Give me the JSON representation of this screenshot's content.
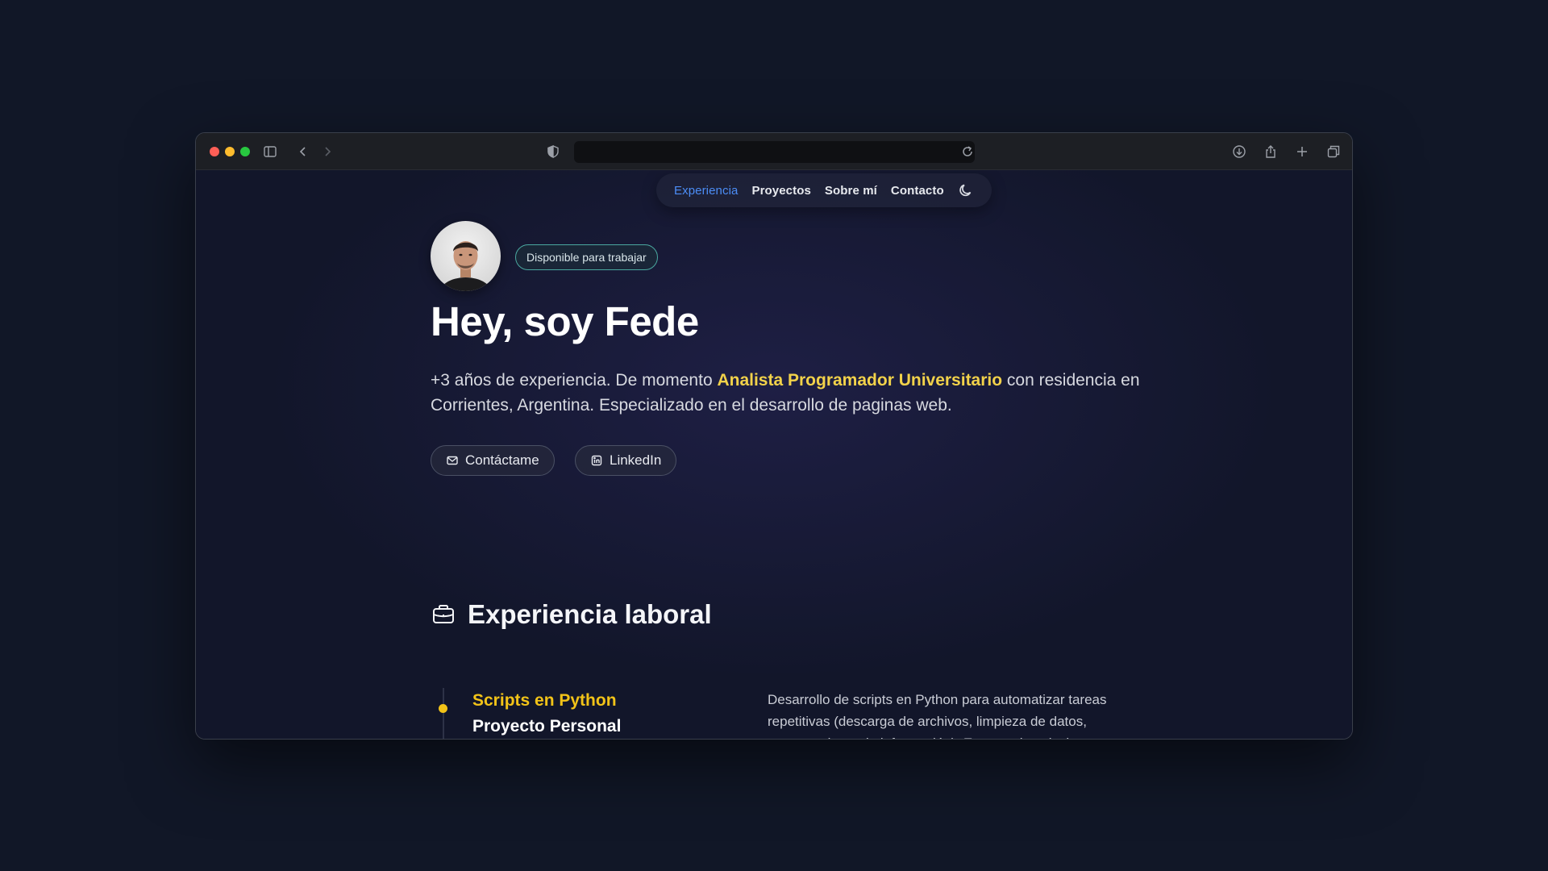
{
  "browser": {
    "url": "",
    "icons": [
      "sidebar-icon",
      "back-icon",
      "forward-icon",
      "shield-icon",
      "reload-icon",
      "download-icon",
      "share-icon",
      "new-tab-icon",
      "tabs-overview-icon"
    ]
  },
  "nav": {
    "items": [
      "Experiencia",
      "Proyectos",
      "Sobre mí",
      "Contacto"
    ],
    "active": "Experiencia",
    "theme_icon": "moon-icon"
  },
  "hero": {
    "badge": "Disponible para trabajar",
    "title": "Hey, soy Fede",
    "intro_before": "+3 años de experiencia. De momento ",
    "intro_highlight": "Analista Programador Universitario",
    "intro_after": " con residencia en Corrientes, Argentina. Especializado en el desarrollo de paginas web.",
    "buttons": {
      "contact": "Contáctame",
      "linkedin": "LinkedIn"
    }
  },
  "experience": {
    "section_title": "Experiencia laboral",
    "items": [
      {
        "role": "Scripts en Python",
        "company": "Proyecto Personal",
        "description": "Desarrollo de scripts en Python para automatizar tareas repetitivas (descarga de archivos, limpieza de datos, procesamiento de información). Entrega de soluciones"
      }
    ]
  },
  "colors": {
    "background": "#111727",
    "accent_yellow": "#f2c318",
    "nav_active": "#4c8df6",
    "badge_border": "#4aa8a0"
  }
}
